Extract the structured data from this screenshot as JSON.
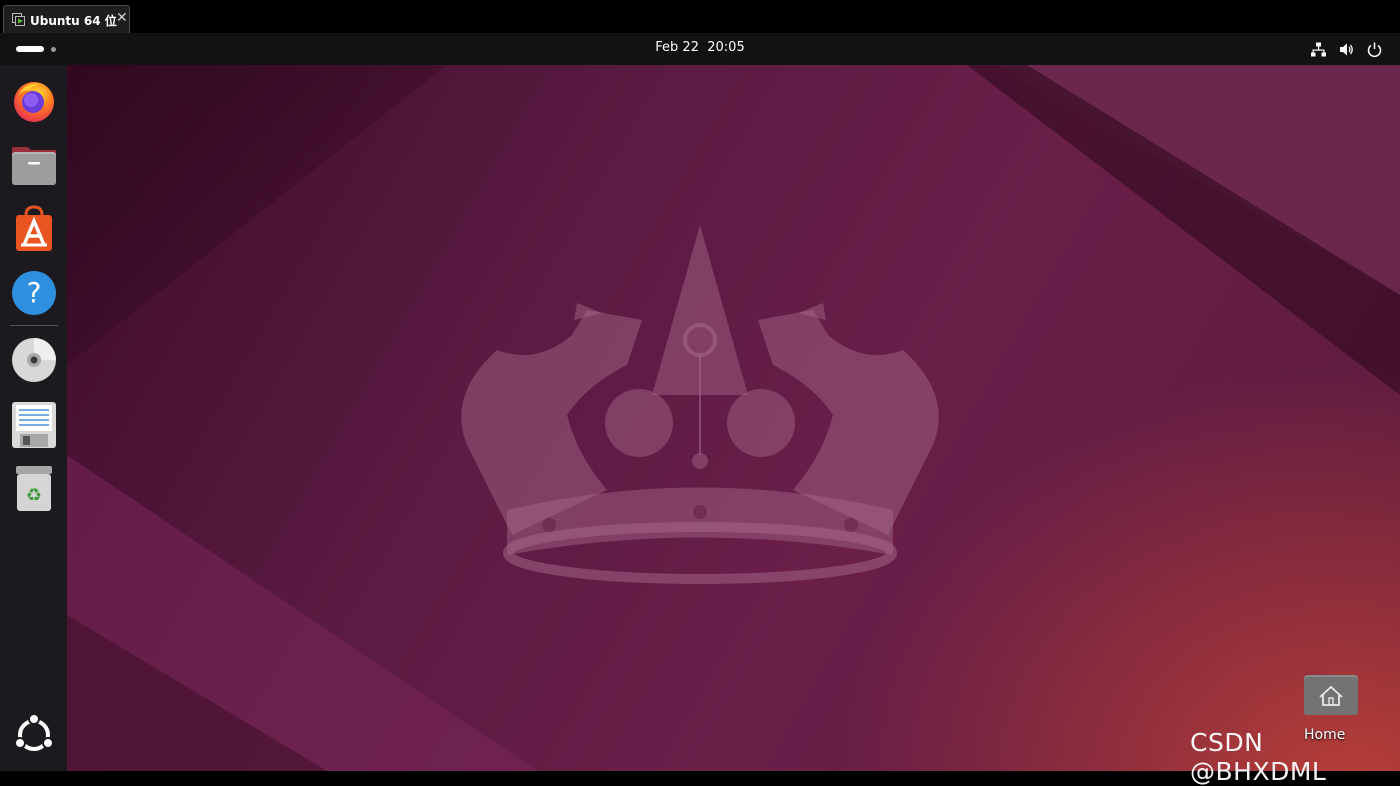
{
  "vm_tab": {
    "title": "Ubuntu 64 位",
    "close_glyph": "✕"
  },
  "topbar": {
    "date": "Feb 22",
    "time": "20:05",
    "tray_icons": [
      "network-icon",
      "volume-icon",
      "power-icon"
    ]
  },
  "dock": {
    "items": [
      {
        "name": "firefox",
        "icon": "firefox-icon"
      },
      {
        "name": "files",
        "icon": "files-icon"
      },
      {
        "name": "app-center",
        "icon": "app-center-icon"
      },
      {
        "name": "help",
        "icon": "help-icon"
      },
      {
        "name": "disc",
        "icon": "disc-icon"
      },
      {
        "name": "text-editor",
        "icon": "text-editor-icon"
      },
      {
        "name": "trash",
        "icon": "trash-icon"
      }
    ],
    "show_apps_icon": "ubuntu-logo-icon"
  },
  "desktop": {
    "icons": [
      {
        "label": "Home",
        "icon": "home-folder-icon"
      }
    ]
  },
  "watermark": "CSDN @BHXDML",
  "colors": {
    "wallpaper_base": "#5b1b42",
    "wallpaper_glow": "#d64a36",
    "topbar": "#121212",
    "dock": "#1c1a1e"
  }
}
